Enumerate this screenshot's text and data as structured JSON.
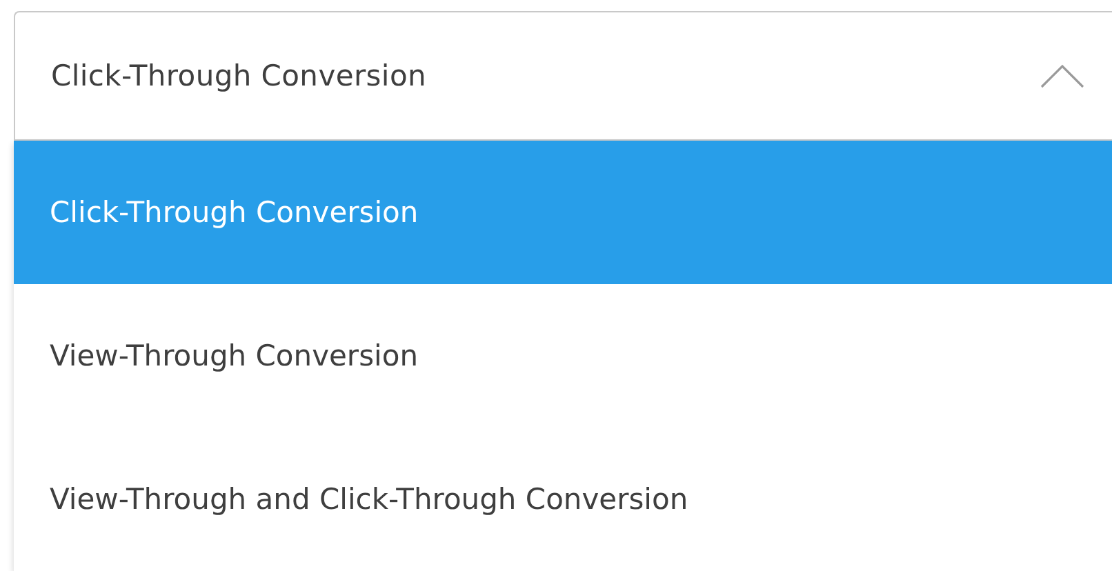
{
  "select": {
    "value": "Click-Through Conversion",
    "expanded": true
  },
  "options": [
    {
      "label": "Click-Through Conversion",
      "selected": true
    },
    {
      "label": "View-Through Conversion",
      "selected": false
    },
    {
      "label": "View-Through and Click-Through Conversion",
      "selected": false
    }
  ]
}
